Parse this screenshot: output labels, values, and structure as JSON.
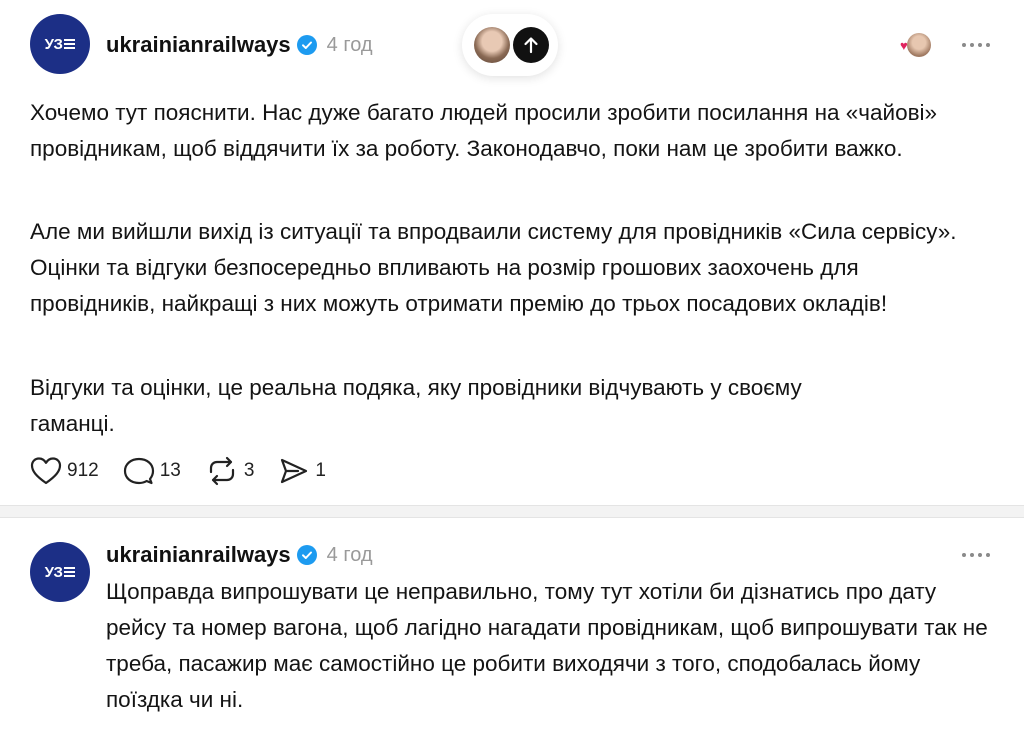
{
  "post1": {
    "avatar_text": "УЗ",
    "username": "ukrainianrailways",
    "time": "4 год",
    "paragraphs": [
      "Хочемо тут пояснити. Нас дуже багато людей просили зробити посилання на «чайові» провідникам, щоб віддячити їх за роботу. Законодавчо, поки нам це зробити важко.",
      "Але ми вийшли вихід із ситуації та впродваили систему для провідників «Сила сервісу». Оцінки та відгуки безпосередньо впливають на розмір грошових заохочень для провідників, найкращі з них можуть отримати премію до трьох посадових окладів!",
      "Відгуки та оцінки, це реальна подяка, яку провідники відчувають у своєму гаманці."
    ],
    "likes": "912",
    "comments": "13",
    "reposts": "3",
    "shares": "1"
  },
  "post2": {
    "avatar_text": "УЗ",
    "username": "ukrainianrailways",
    "time": "4 год",
    "text": "Щоправда випрошувати це неправильно, тому тут хотіли би дізнатись про дату рейсу та номер вагона, щоб лагідно нагадати провідникам, щоб випрошувати так не треба, пасажир має самостійно це робити виходячи з того, сподобалась йому поїздка чи ні."
  },
  "colors": {
    "avatar_bg": "#1c2f86",
    "verified": "#1d9bf0",
    "muted": "#9a9a9a"
  },
  "icons": [
    "heart-icon",
    "comment-icon",
    "repost-icon",
    "share-icon",
    "verified-icon",
    "more-icon",
    "arrow-up-icon"
  ]
}
